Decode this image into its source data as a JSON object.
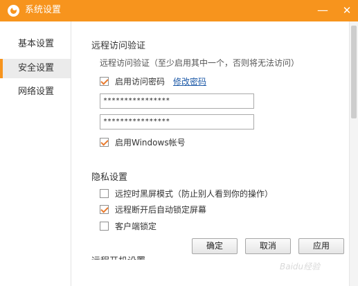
{
  "window": {
    "title": "系统设置",
    "minimize_label": "—",
    "close_label": "✕"
  },
  "sidebar": {
    "items": [
      {
        "label": "基本设置",
        "active": false
      },
      {
        "label": "安全设置",
        "active": true
      },
      {
        "label": "网络设置",
        "active": false
      }
    ]
  },
  "remote_access": {
    "section_title": "远程访问验证",
    "hint": "远程访问验证（至少启用其中一个，否则将无法访问）",
    "enable_password_label": "启用访问密码",
    "enable_password_checked": true,
    "change_password_link": "修改密码",
    "password_value": "****************",
    "confirm_password_value": "****************",
    "enable_windows_account_label": "启用Windows帐号",
    "enable_windows_account_checked": true
  },
  "privacy": {
    "section_title": "隐私设置",
    "black_screen_label": "远控时黑屏模式（防止别人看到你的操作）",
    "black_screen_checked": false,
    "auto_lock_label": "远程断开后自动锁定屏幕",
    "auto_lock_checked": true,
    "client_lock_label": "客户端锁定",
    "client_lock_checked": false
  },
  "next_section_title": "远程开机设置",
  "buttons": {
    "ok": "确定",
    "cancel": "取消",
    "apply": "应用"
  },
  "watermark": "Baidu经验",
  "colors": {
    "accent": "#f7941d",
    "link": "#1e5aa8",
    "check": "#e87a2e"
  }
}
